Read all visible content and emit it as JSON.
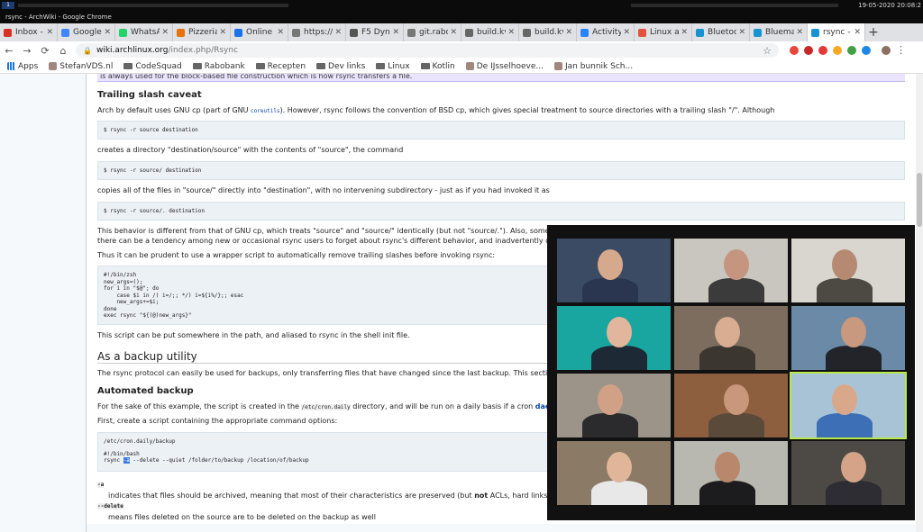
{
  "system": {
    "workspace": "1",
    "window_title": "rsync - ArchWiki - Google Chrome",
    "clock": "19-05-2020 20:08:2"
  },
  "tabs": [
    {
      "label": "Inbox - s",
      "color": "#d93025"
    },
    {
      "label": "Google",
      "color": "#4285f4"
    },
    {
      "label": "WhatsA",
      "color": "#25d366"
    },
    {
      "label": "Pizzeria",
      "color": "#e8710a"
    },
    {
      "label": "Online K",
      "color": "#1a73e8"
    },
    {
      "label": "https://t",
      "color": "#777777"
    },
    {
      "label": "F5 Dyna",
      "color": "#555555"
    },
    {
      "label": "git.rabo",
      "color": "#777777"
    },
    {
      "label": "build.kv",
      "color": "#666666"
    },
    {
      "label": "build.kv",
      "color": "#666666"
    },
    {
      "label": "Activity",
      "color": "#2684ff"
    },
    {
      "label": "Linux an",
      "color": "#e0533c"
    },
    {
      "label": "Bluetoo",
      "color": "#1793d1"
    },
    {
      "label": "Blueman",
      "color": "#1793d1"
    },
    {
      "label": "rsync - A",
      "color": "#1793d1",
      "active": true
    }
  ],
  "omnibox": {
    "host": "wiki.archlinux.org",
    "path": "/index.php/Rsync"
  },
  "bookmarks": [
    {
      "label": "Apps",
      "kind": "apps"
    },
    {
      "label": "StefanVDS.nl",
      "kind": "site"
    },
    {
      "label": "CodeSquad",
      "kind": "folder"
    },
    {
      "label": "Rabobank",
      "kind": "folder"
    },
    {
      "label": "Recepten",
      "kind": "folder"
    },
    {
      "label": "Dev links",
      "kind": "folder"
    },
    {
      "label": "Linux",
      "kind": "folder"
    },
    {
      "label": "Kotlin",
      "kind": "folder"
    },
    {
      "label": "De IJsselhoeve...",
      "kind": "site"
    },
    {
      "label": "Jan bunnik Sch...",
      "kind": "site"
    }
  ],
  "article": {
    "note_text": "is always used for the block-based file construction which is how rsync transfers a file.",
    "h_trailing": "Trailing slash caveat",
    "p1_a": "Arch by default uses GNU cp (part of GNU ",
    "p1_link": "coreutils",
    "p1_b": "). However, rsync follows the convention of BSD cp, which gives special treatment to source directories with a trailing slash \"/\". Although",
    "code1": "$ rsync -r source destination",
    "p2": "creates a directory \"destination/source\" with the contents of \"source\", the command",
    "code2": "$ rsync -r source/ destination",
    "p3": "copies all of the files in \"source/\" directly into \"destination\", with no intervening subdirectory - just as if you had invoked it as",
    "code3": "$ rsync -r source/. destination",
    "p4": "This behavior is different from that of GNU cp, which treats \"source\" and \"source/\" identically (but not \"source/.\"). Also, some shells a",
    "p4b": "there can be a tendency among new or occasional rsync users to forget about rsync's different behavior, and inadvertently create a",
    "p5": "Thus it can be prudent to use a wrapper script to automatically remove trailing slashes before invoking rsync:",
    "code4": "#!/bin/zsh\nnew_args=();\nfor i in \"$@\"; do\n    case $i in /) i=/;; */) i=${i%/};; esac\n    new_args+=$i;\ndone\nexec rsync \"${(@)new_args}\"",
    "p6": "This script can be put somewhere in the path, and aliased to rsync in the shell init file.",
    "h_backup": "As a backup utility",
    "p7": "The rsync protocol can easily be used for backups, only transferring files that have changed since the last backup. This section desc",
    "h_auto": "Automated backup",
    "p8_a": "For the sake of this example, the script is created in the ",
    "p8_code": "/etc/cron.daily",
    "p8_b": " directory, and will be run on a daily basis if a cron ",
    "p8_link": "daemon",
    "p9": "First, create a script containing the appropriate command options:",
    "code5_a": "/etc/cron.daily/backup",
    "code5_b": "#!/bin/bash",
    "code5_c1": "rsync ",
    "code5_hl": "-a",
    "code5_c2": " --delete --quiet /folder/to/backup /location/of/backup",
    "dt1": "-a",
    "dd1_a": "indicates that files should be archived, meaning that most of their characteristics are preserved (but ",
    "dd1_b": "not",
    "dd1_c": " ACLs, hard links or exte",
    "dt2": "--delete",
    "dd2": "means files deleted on the source are to be deleted on the backup as well"
  },
  "video_call": {
    "tiles": [
      {
        "bg": "#3a4b63",
        "skin": "#d7a98c",
        "shirt": "#2a3550",
        "speaking": false
      },
      {
        "bg": "#c9c6c0",
        "skin": "#c59580",
        "shirt": "#3b3b3b",
        "speaking": false
      },
      {
        "bg": "#d9d5cf",
        "skin": "#b68a72",
        "shirt": "#4d4a44",
        "speaking": false
      },
      {
        "bg": "#1aa6a0",
        "skin": "#e2b69c",
        "shirt": "#1d2a36",
        "speaking": false
      },
      {
        "bg": "#7d6d5f",
        "skin": "#d8ad92",
        "shirt": "#3c3630",
        "speaking": false
      },
      {
        "bg": "#6a8aa8",
        "skin": "#c8997e",
        "shirt": "#22242a",
        "speaking": false
      },
      {
        "bg": "#9c9488",
        "skin": "#d1a186",
        "shirt": "#2b2b2e",
        "speaking": false
      },
      {
        "bg": "#8e5f3e",
        "skin": "#c9977a",
        "shirt": "#5a4a3a",
        "speaking": false
      },
      {
        "bg": "#a9c3d6",
        "skin": "#d9a88a",
        "shirt": "#3c6fb5",
        "speaking": true
      },
      {
        "bg": "#8a7a66",
        "skin": "#e0b59a",
        "shirt": "#e8e8e8",
        "speaking": false
      },
      {
        "bg": "#b8b8b0",
        "skin": "#b9876b",
        "shirt": "#1c1c1e",
        "speaking": false
      },
      {
        "bg": "#4d4a46",
        "skin": "#d5a488",
        "shirt": "#2d2d33",
        "speaking": false
      }
    ]
  }
}
